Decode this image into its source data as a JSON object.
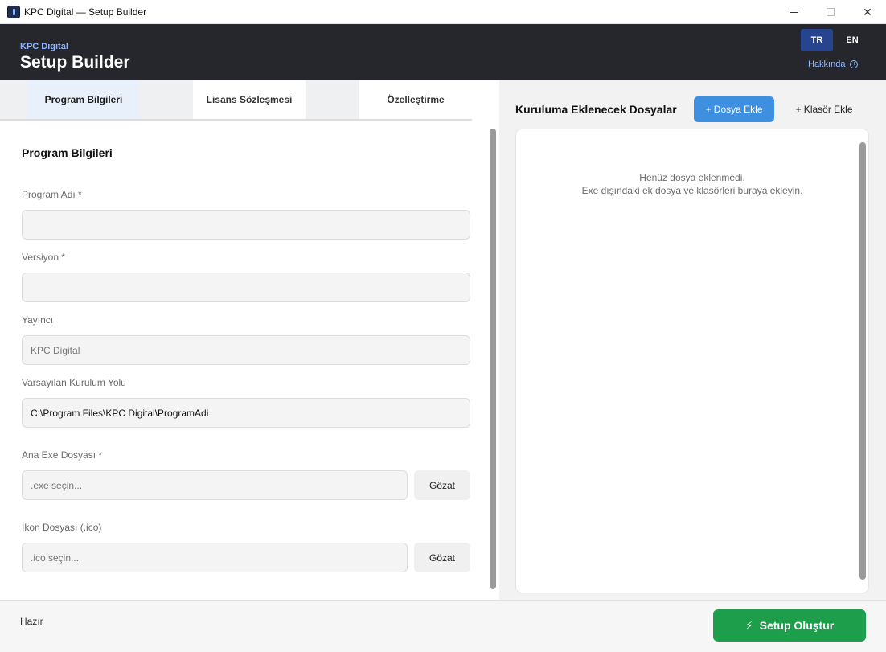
{
  "window": {
    "title": "KPC Digital — Setup Builder",
    "minimize": "minimize",
    "maximize": "maximize",
    "close": "✕"
  },
  "header": {
    "brand_small": "KPC Digital",
    "brand_title": "Setup Builder",
    "languages": [
      "TR",
      "EN"
    ],
    "selected_language": "TR",
    "about_label": "Hakkında",
    "about_icon": "i"
  },
  "tabs": [
    {
      "label": "Program Bilgileri",
      "active": true
    },
    {
      "label": "Lisans Sözleşmesi",
      "active": false
    },
    {
      "label": "Özelleştirme",
      "active": false
    }
  ],
  "form": {
    "section_title": "Program Bilgileri",
    "fields": [
      {
        "label": "Program Adı *",
        "value": "",
        "placeholder": ""
      },
      {
        "label": "Versiyon *",
        "value": "",
        "placeholder": ""
      },
      {
        "label": "Yayıncı",
        "value": "",
        "placeholder": "KPC Digital"
      },
      {
        "label": "Varsayılan Kurulum Yolu",
        "value": "C:\\Program Files\\KPC Digital\\ProgramAdi",
        "placeholder": ""
      },
      {
        "label": "Ana Exe Dosyası *",
        "value": "",
        "placeholder": ".exe seçin..."
      },
      {
        "label": "İkon Dosyası (.ico)",
        "value": "",
        "placeholder": ".ico seçin..."
      }
    ],
    "browse_label": "Gözat"
  },
  "files_panel": {
    "title": "Kuruluma Eklenecek Dosyalar",
    "add_file_label": "+ Dosya Ekle",
    "add_folder_label": "+ Klasör Ekle",
    "empty_line1": "Henüz dosya eklenmedi.",
    "empty_line2": "Exe dışındaki ek dosya ve klasörleri buraya ekleyin."
  },
  "footer": {
    "status": "Hazır",
    "create_label": "Setup Oluştur",
    "create_icon": "⚡"
  },
  "colors": {
    "header_bg": "#25272c",
    "accent_blue": "#3f8fe0",
    "lang_active": "#27448e",
    "success_green": "#1d9e4a",
    "brand_link": "#8fb8ff"
  }
}
